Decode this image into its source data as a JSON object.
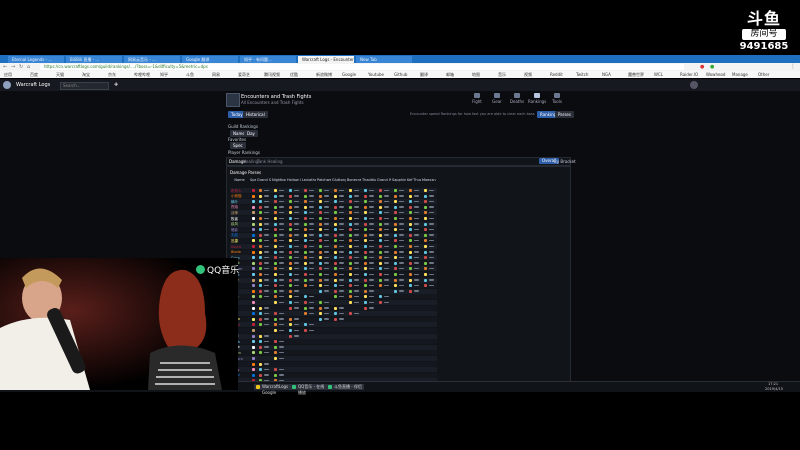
{
  "overlay": {
    "platform_mark": "斗鱼",
    "room_label": "房间号",
    "room_number": "9491685"
  },
  "browser": {
    "tabs": [
      "Eternal Legends - ...",
      "BiliBili 直播 - ...",
      "网易云音乐 - ...",
      "Google 翻译",
      "知乎 - 有问题...",
      "Warcraft Logs - Encounter Analysis",
      "New Tab"
    ],
    "active_tab": 5,
    "url": "https://cn.warcraftlogs.com/guild/rankings/..../?boss=-1&difficulty=5&metric=dps",
    "bookmarks": [
      "应用",
      "百度",
      "天猫",
      "淘宝",
      "京东",
      "哔哩哔哩",
      "知乎",
      "斗鱼",
      "网易",
      "爱奇艺",
      "腾讯视频",
      "优酷",
      "新浪微博",
      "Google",
      "Youtube",
      "Github",
      "翻译",
      "邮箱",
      "地图",
      "音乐",
      "视频",
      "Reddit",
      "Twitch",
      "NGA",
      "魔兽世界",
      "WCL",
      "Raider.IO",
      "Wowhead",
      "Manage",
      "Other"
    ]
  },
  "appbar": {
    "site_name": "Warcraft Logs",
    "search_placeholder": "Search..."
  },
  "guild": {
    "title": "Encounters and Trash Fights",
    "subtitle": "All Encounters and Trash Fights",
    "nav": [
      "Fight",
      "Gear",
      "Deaths",
      "Rankings",
      "Tools"
    ],
    "nav_selected": 3
  },
  "controls": {
    "today": "Today",
    "historical": "Historical",
    "rankings": "Rankings",
    "parses": "Parses",
    "note": "Encounter speed Rankings for how fast you are able to clear each boss",
    "guild_rankings": "Guild Rankings",
    "name": "Name",
    "day": "Day",
    "favorites": "Favorites",
    "spec": "Spec",
    "player_rankings": "Player Rankings",
    "damage": "Damage",
    "healing": "Healing",
    "tank": "Tank Healing",
    "overall": "Overall",
    "by_bracket": "By Bracket"
  },
  "table": {
    "title": "Damage Parses",
    "columns": [
      "Name",
      "Spec",
      "Grand Swordsman",
      "Nightborne",
      "Hollow Grove",
      "Leviathan",
      "Patchwerk",
      "Gluttony",
      "Bonecraft",
      "Thaddius",
      "Grand Wid",
      "Sapphiron",
      "Kel'Thuzad",
      "Maexxna"
    ],
    "players": [
      {
        "n": "布刻人",
        "c": "#c41f3b"
      },
      {
        "n": "小熊猫",
        "c": "#ff7d0a"
      },
      {
        "n": "枫叶",
        "c": "#69ccf0"
      },
      {
        "n": "烈焰",
        "c": "#f58cba"
      },
      {
        "n": "战神",
        "c": "#c79c6e"
      },
      {
        "n": "牧者",
        "c": "#ffffff"
      },
      {
        "n": "疾风",
        "c": "#abd473"
      },
      {
        "n": "暗影",
        "c": "#9482c9"
      },
      {
        "n": "无敌",
        "c": "#0070de"
      },
      {
        "n": "迅捷",
        "c": "#fff569"
      },
      {
        "n": "Asura",
        "c": "#c41f3b"
      },
      {
        "n": "Blade",
        "c": "#ff7d0a"
      },
      {
        "n": "Coco",
        "c": "#69ccf0"
      },
      {
        "n": "Dusk",
        "c": "#abd473"
      },
      {
        "n": "Ember",
        "c": "#9482c9"
      },
      {
        "n": "Frost",
        "c": "#69ccf0"
      },
      {
        "n": "Gale",
        "c": "#c79c6e"
      },
      {
        "n": "Hex",
        "c": "#9482c9"
      },
      {
        "n": "Ivy",
        "c": "#ff7d0a"
      },
      {
        "n": "Jade",
        "c": "#abd473"
      },
      {
        "n": "Kira",
        "c": "#f58cba"
      },
      {
        "n": "Lux",
        "c": "#ffffff"
      },
      {
        "n": "Mist",
        "c": "#0070de"
      },
      {
        "n": "Nova",
        "c": "#fff569"
      },
      {
        "n": "Onyx",
        "c": "#c41f3b"
      },
      {
        "n": "Pike",
        "c": "#c79c6e"
      },
      {
        "n": "Quill",
        "c": "#9482c9"
      },
      {
        "n": "Rune",
        "c": "#69ccf0"
      },
      {
        "n": "Sage",
        "c": "#ffffff"
      },
      {
        "n": "Thorn",
        "c": "#abd473"
      },
      {
        "n": "Umbra",
        "c": "#9482c9"
      },
      {
        "n": "Vex",
        "c": "#ff7d0a"
      },
      {
        "n": "Wisp",
        "c": "#f58cba"
      },
      {
        "n": "Xeno",
        "c": "#0070de"
      },
      {
        "n": "Yuri",
        "c": "#c41f3b"
      }
    ]
  },
  "taskbar": {
    "items": [
      "WarcraftLogs - Google",
      "QQ音乐 - 在线播放",
      "斗鱼直播 - 伴侣"
    ],
    "clock": "17:21",
    "date": "2019/4/15"
  },
  "webcam": {
    "music_badge": "QQ音乐"
  },
  "colors": {
    "tabbar": "#1f6fc1",
    "site_bg": "#0a0c10",
    "accent": "#2e5fa8"
  }
}
